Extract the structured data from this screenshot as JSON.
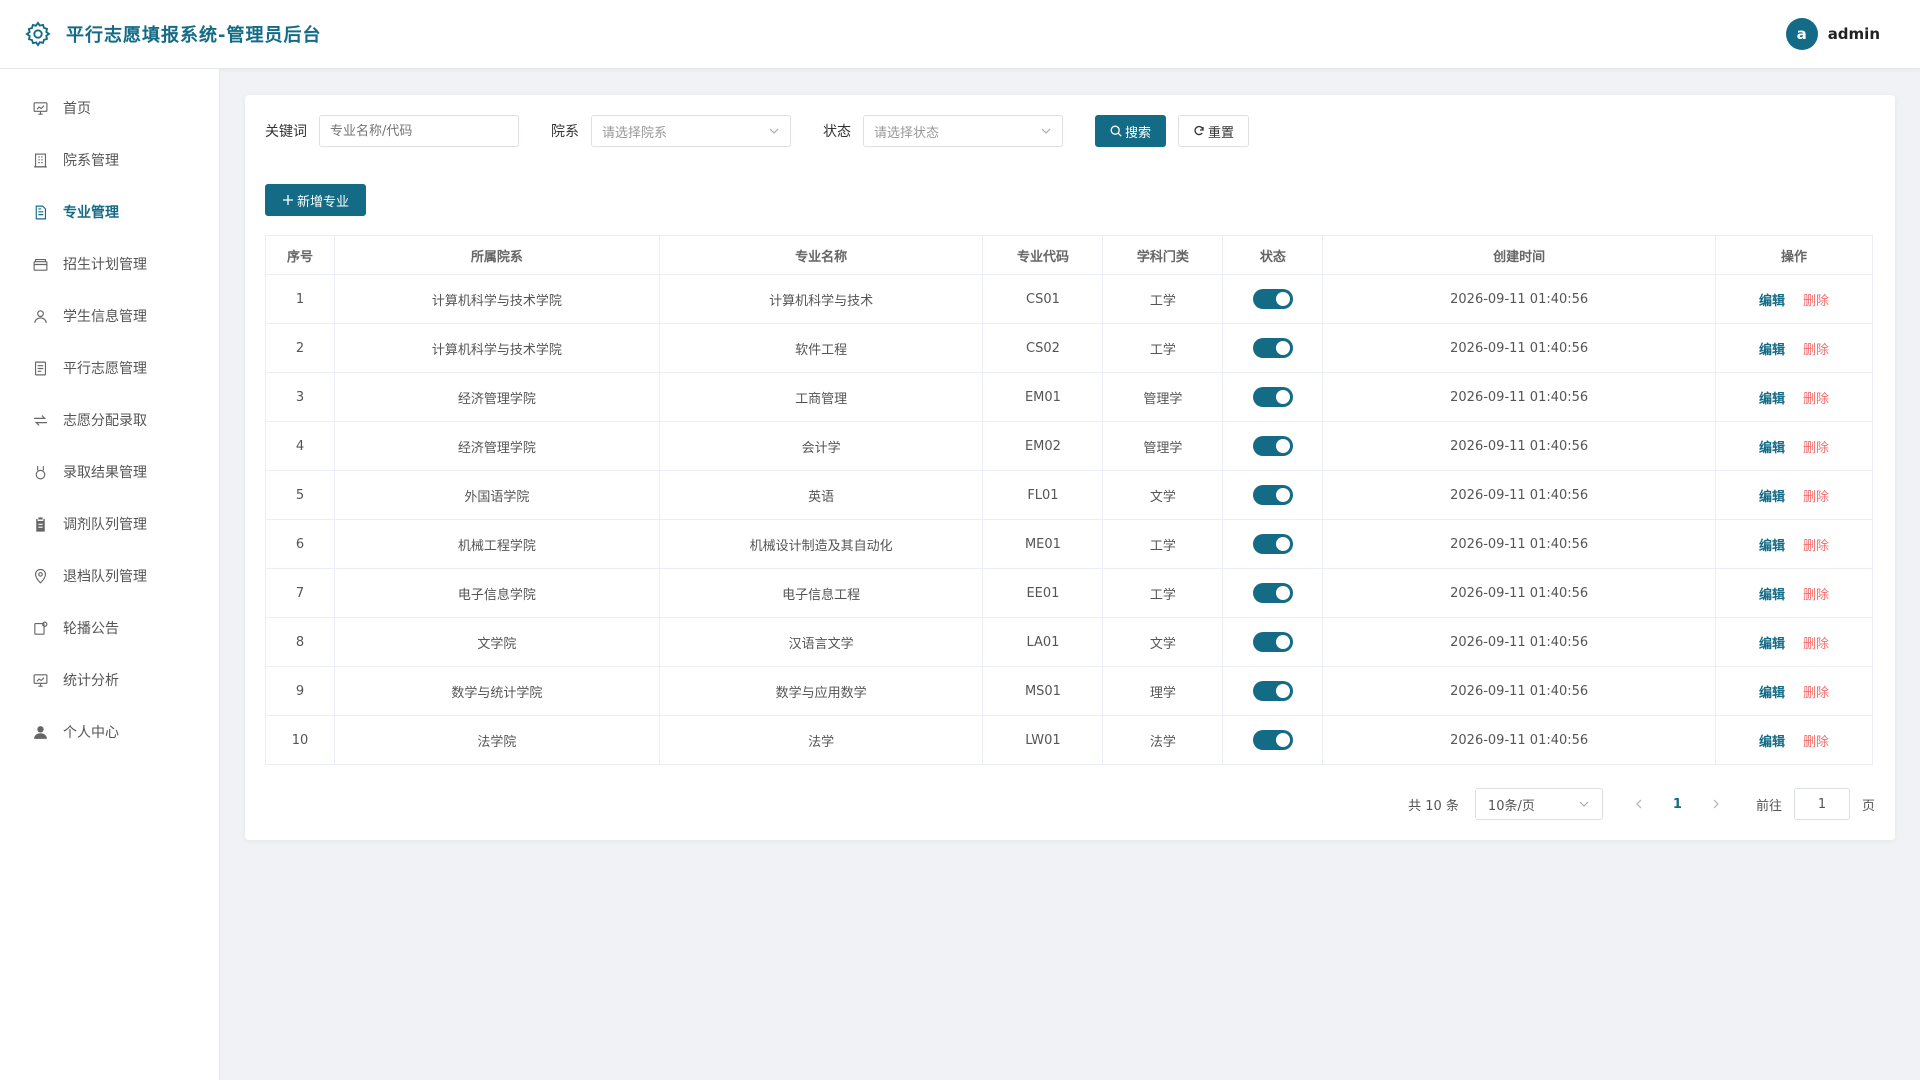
{
  "header": {
    "title": "平行志愿填报系统-管理员后台",
    "avatar_letter": "a",
    "username": "admin"
  },
  "sidebar": {
    "items": [
      {
        "label": "首页",
        "icon": "dashboard-icon"
      },
      {
        "label": "院系管理",
        "icon": "building-icon"
      },
      {
        "label": "专业管理",
        "icon": "document-icon",
        "active": true
      },
      {
        "label": "招生计划管理",
        "icon": "box-icon"
      },
      {
        "label": "学生信息管理",
        "icon": "user-icon"
      },
      {
        "label": "平行志愿管理",
        "icon": "list-icon"
      },
      {
        "label": "志愿分配录取",
        "icon": "switch-icon"
      },
      {
        "label": "录取结果管理",
        "icon": "medal-icon"
      },
      {
        "label": "调剂队列管理",
        "icon": "clipboard-icon"
      },
      {
        "label": "退档队列管理",
        "icon": "location-icon"
      },
      {
        "label": "轮播公告",
        "icon": "notice-icon"
      },
      {
        "label": "统计分析",
        "icon": "chart-icon"
      },
      {
        "label": "个人中心",
        "icon": "person-icon"
      }
    ]
  },
  "filters": {
    "keyword_label": "关键词",
    "keyword_placeholder": "专业名称/代码",
    "dept_label": "院系",
    "dept_placeholder": "请选择院系",
    "status_label": "状态",
    "status_placeholder": "请选择状态",
    "search_label": "搜索",
    "reset_label": "重置"
  },
  "add_button_label": "新增专业",
  "table": {
    "columns": [
      "序号",
      "所属院系",
      "专业名称",
      "专业代码",
      "学科门类",
      "状态",
      "创建时间",
      "操作"
    ],
    "edit_label": "编辑",
    "delete_label": "删除",
    "rows": [
      {
        "no": "1",
        "dept": "计算机科学与技术学院",
        "name": "计算机科学与技术",
        "code": "CS01",
        "category": "工学",
        "enabled": true,
        "created": "2026-09-11 01:40:56"
      },
      {
        "no": "2",
        "dept": "计算机科学与技术学院",
        "name": "软件工程",
        "code": "CS02",
        "category": "工学",
        "enabled": true,
        "created": "2026-09-11 01:40:56"
      },
      {
        "no": "3",
        "dept": "经济管理学院",
        "name": "工商管理",
        "code": "EM01",
        "category": "管理学",
        "enabled": true,
        "created": "2026-09-11 01:40:56"
      },
      {
        "no": "4",
        "dept": "经济管理学院",
        "name": "会计学",
        "code": "EM02",
        "category": "管理学",
        "enabled": true,
        "created": "2026-09-11 01:40:56"
      },
      {
        "no": "5",
        "dept": "外国语学院",
        "name": "英语",
        "code": "FL01",
        "category": "文学",
        "enabled": true,
        "created": "2026-09-11 01:40:56"
      },
      {
        "no": "6",
        "dept": "机械工程学院",
        "name": "机械设计制造及其自动化",
        "code": "ME01",
        "category": "工学",
        "enabled": true,
        "created": "2026-09-11 01:40:56"
      },
      {
        "no": "7",
        "dept": "电子信息学院",
        "name": "电子信息工程",
        "code": "EE01",
        "category": "工学",
        "enabled": true,
        "created": "2026-09-11 01:40:56"
      },
      {
        "no": "8",
        "dept": "文学院",
        "name": "汉语言文学",
        "code": "LA01",
        "category": "文学",
        "enabled": true,
        "created": "2026-09-11 01:40:56"
      },
      {
        "no": "9",
        "dept": "数学与统计学院",
        "name": "数学与应用数学",
        "code": "MS01",
        "category": "理学",
        "enabled": true,
        "created": "2026-09-11 01:40:56"
      },
      {
        "no": "10",
        "dept": "法学院",
        "name": "法学",
        "code": "LW01",
        "category": "法学",
        "enabled": true,
        "created": "2026-09-11 01:40:56"
      }
    ]
  },
  "pagination": {
    "total_text": "共 10 条",
    "page_size": "10条/页",
    "current_page": "1",
    "goto_label": "前往",
    "goto_value": "1",
    "page_unit": "页"
  },
  "colors": {
    "primary": "#146b86",
    "danger": "#f56c6c"
  }
}
